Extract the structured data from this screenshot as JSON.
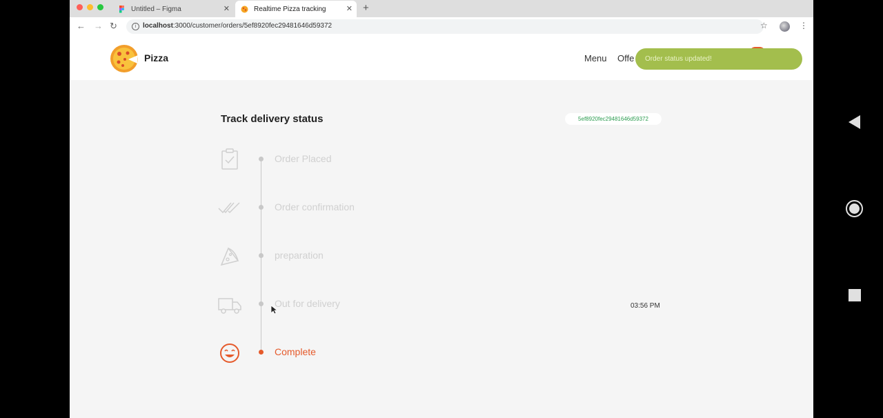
{
  "browser": {
    "tabs": [
      {
        "title": "Untitled – Figma",
        "active": false
      },
      {
        "title": "Realtime Pizza tracking",
        "active": true
      }
    ],
    "url_host": "localhost",
    "url_path": ":3000/customer/orders/5ef8920fec29481646d59372"
  },
  "header": {
    "brand": "Pizza",
    "nav": [
      "Menu",
      "Offe"
    ],
    "toast": "Order status updated!"
  },
  "tracker": {
    "title": "Track delivery status",
    "order_id": "5ef8920fec29481646d59372",
    "steps": [
      {
        "label": "Order Placed",
        "icon": "clipboard-check-icon",
        "state": "pending"
      },
      {
        "label": "Order confirmation",
        "icon": "double-check-icon",
        "state": "pending"
      },
      {
        "label": "preparation",
        "icon": "pizza-slice-icon",
        "state": "pending"
      },
      {
        "label": "Out for delivery",
        "icon": "truck-icon",
        "state": "pending"
      },
      {
        "label": "Complete",
        "icon": "smiley-icon",
        "state": "completed"
      }
    ],
    "updated_time": "03:56 PM"
  },
  "colors": {
    "accent": "#e55a2b",
    "toast": "#a3be4d",
    "order_id": "#2b9c4f"
  }
}
